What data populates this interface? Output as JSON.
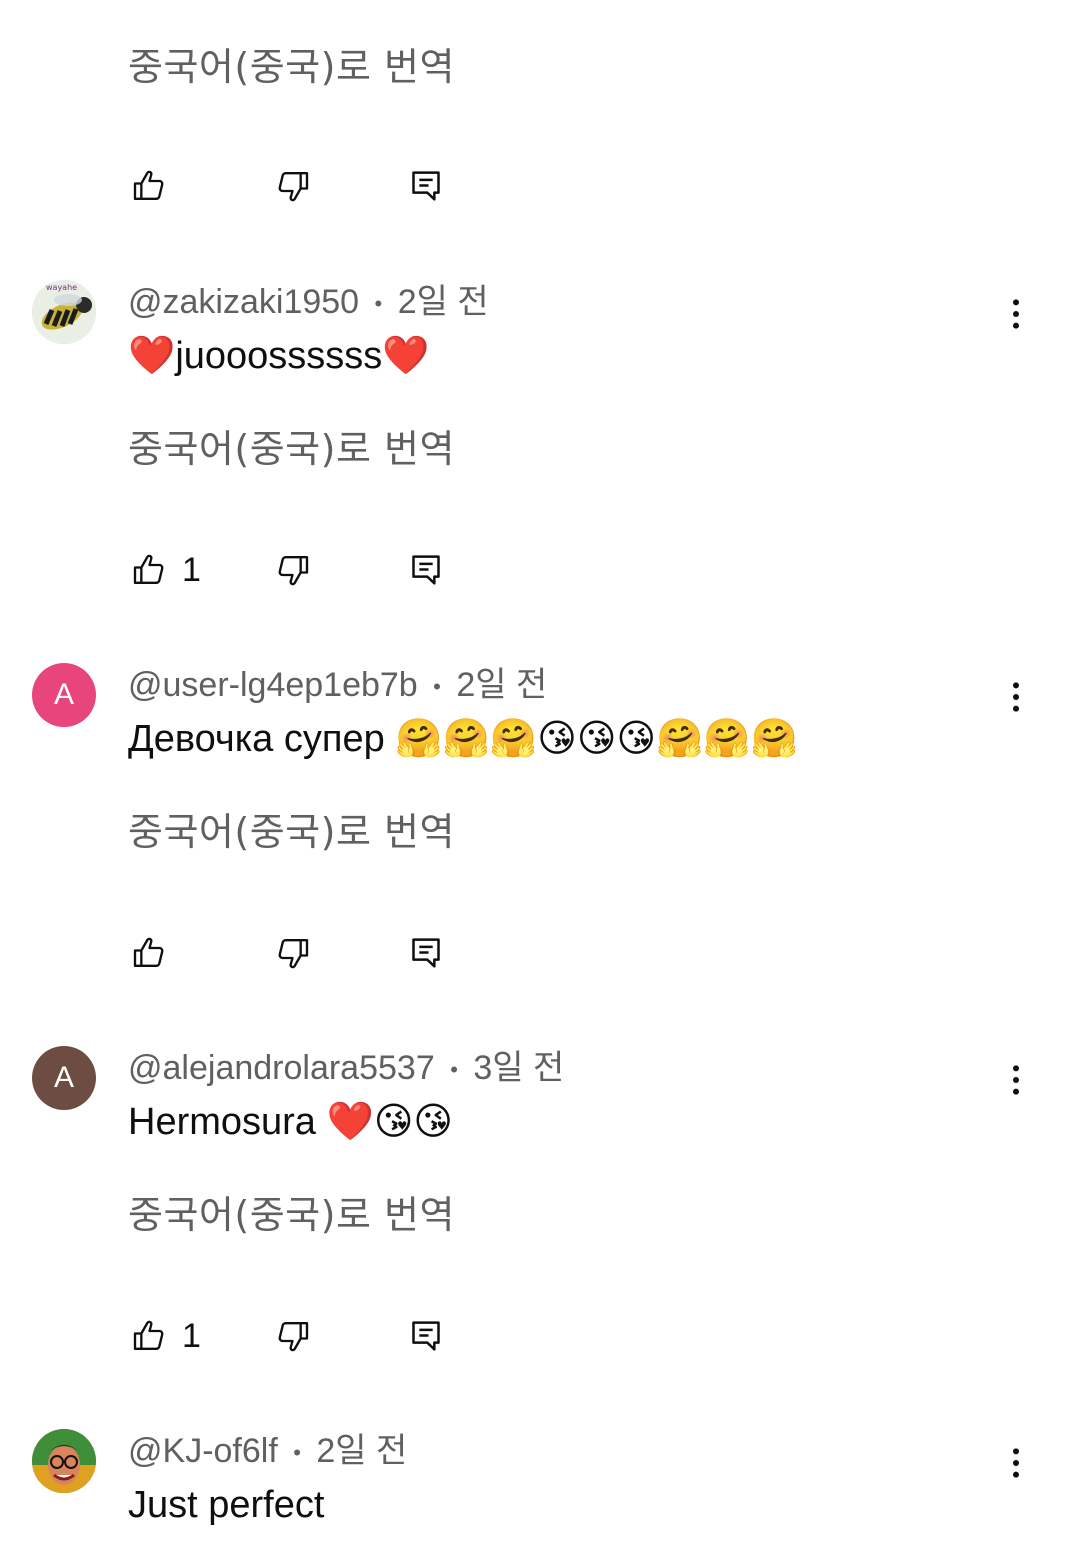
{
  "colors": {
    "secondary_text": "#606060",
    "primary_text": "#0f0f0f",
    "avatar_pink": "#e8457d",
    "avatar_brown": "#6d4c41"
  },
  "icons": {
    "like": "thumb-up-icon",
    "dislike": "thumb-down-icon",
    "reply": "reply-comment-icon",
    "menu": "more-vert-icon"
  },
  "top": {
    "translate_label": "중국어(중국)로 번역",
    "like_count": ""
  },
  "comments": [
    {
      "handle": "@zakizaki1950",
      "separator": "•",
      "time": "2일 전",
      "text": "❤️juooossssss❤️",
      "translate_label": "중국어(중국)로 번역",
      "like_count": "1",
      "avatar_initial": "",
      "avatar_text": "wayahe"
    },
    {
      "handle": "@user-lg4ep1eb7b",
      "separator": "•",
      "time": "2일 전",
      "text": "Девочка супер 🤗🤗🤗😘😘😘🤗🤗🤗",
      "translate_label": "중국어(중국)로 번역",
      "like_count": "",
      "avatar_initial": "A"
    },
    {
      "handle": "@alejandrolara5537",
      "separator": "•",
      "time": "3일 전",
      "text": "Hermosura ❤️😘😘",
      "translate_label": "중국어(중국)로 번역",
      "like_count": "1",
      "avatar_initial": "A"
    },
    {
      "handle": "@KJ-of6lf",
      "separator": "•",
      "time": "2일 전",
      "text": "Just perfect",
      "avatar_initial": ""
    }
  ]
}
